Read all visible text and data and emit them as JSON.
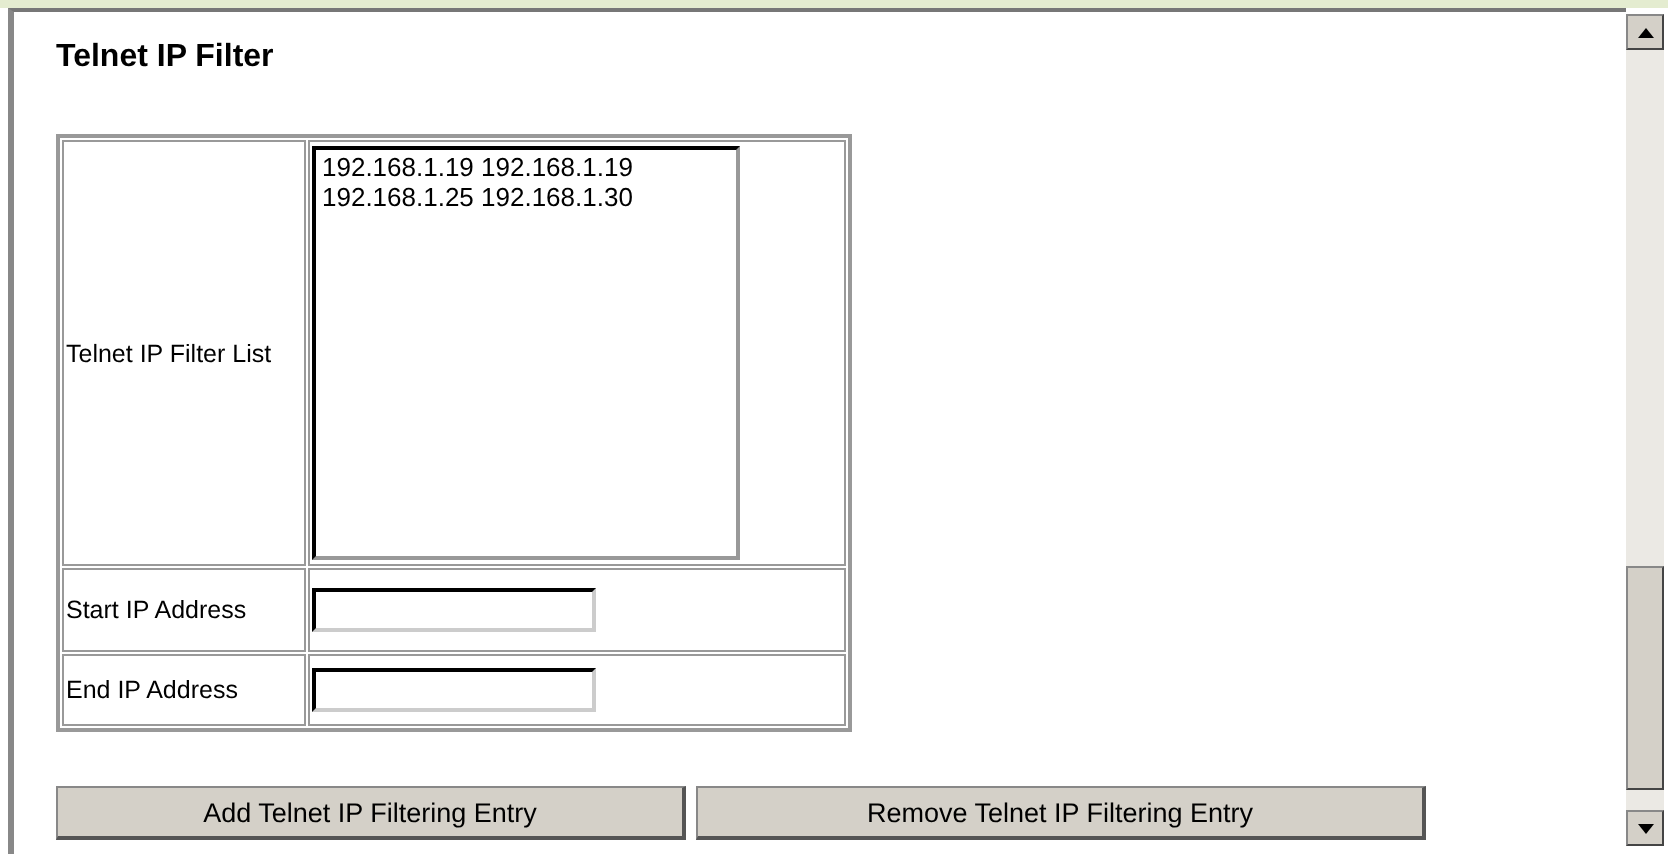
{
  "title": "Telnet IP Filter",
  "filter_list": {
    "label": "Telnet IP Filter List",
    "items": [
      {
        "text": "192.168.1.19 192.168.1.19",
        "selected": false
      },
      {
        "text": "192.168.1.25 192.168.1.30",
        "selected": false
      }
    ]
  },
  "fields": [
    {
      "label": "Start IP Address"
    },
    {
      "label": "End IP Address"
    }
  ],
  "buttons": [
    "Add Telnet IP Filtering Entry",
    "Remove Telnet IP Filtering Entry"
  ]
}
